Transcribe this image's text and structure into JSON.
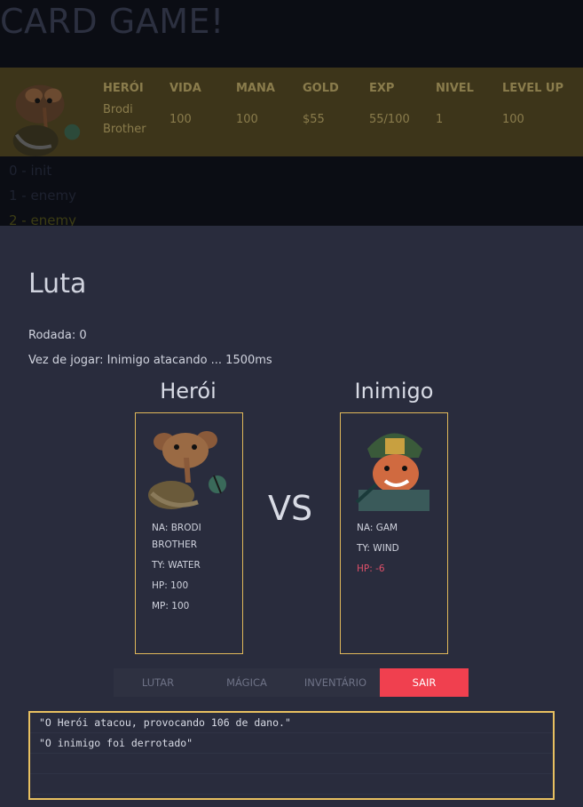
{
  "header": {
    "title": "CARD GAME!"
  },
  "stats": {
    "headers": [
      "HERÓI",
      "VIDA",
      "MANA",
      "GOLD",
      "EXP",
      "NIVEL",
      "LEVEL UP"
    ],
    "values": [
      "Brodi Brother",
      "100",
      "100",
      "$55",
      "55/100",
      "1",
      "100"
    ]
  },
  "event_log": [
    {
      "text": "0 - init",
      "active": false
    },
    {
      "text": "1 - enemy",
      "active": false
    },
    {
      "text": "2 - enemy",
      "active": true
    }
  ],
  "battle": {
    "title": "Luta",
    "round": "Rodada: 0",
    "turn": "Vez de jogar: Inimigo atacando ... 1500ms",
    "hero_label": "Herói",
    "enemy_label": "Inimigo",
    "vs": "VS",
    "hero_card": {
      "name": "NA: BRODI BROTHER",
      "type": "TY: WATER",
      "hp": "HP: 100",
      "mp": "MP: 100"
    },
    "enemy_card": {
      "name": "NA: GAM",
      "type": "TY: WIND",
      "hp": "HP: -6"
    }
  },
  "actions": {
    "fight": "LUTAR",
    "magic": "MÁGICA",
    "inventory": "INVENTÁRIO",
    "exit": "SAIR"
  },
  "battle_log": [
    "\"O Herói atacou, provocando 106 de dano.\"",
    "\"O inimigo foi derrotado\"",
    "",
    ""
  ],
  "colors": {
    "accent_border": "#e0b85a",
    "exit_button": "#f0404f",
    "hp_low": "#e0506a"
  }
}
